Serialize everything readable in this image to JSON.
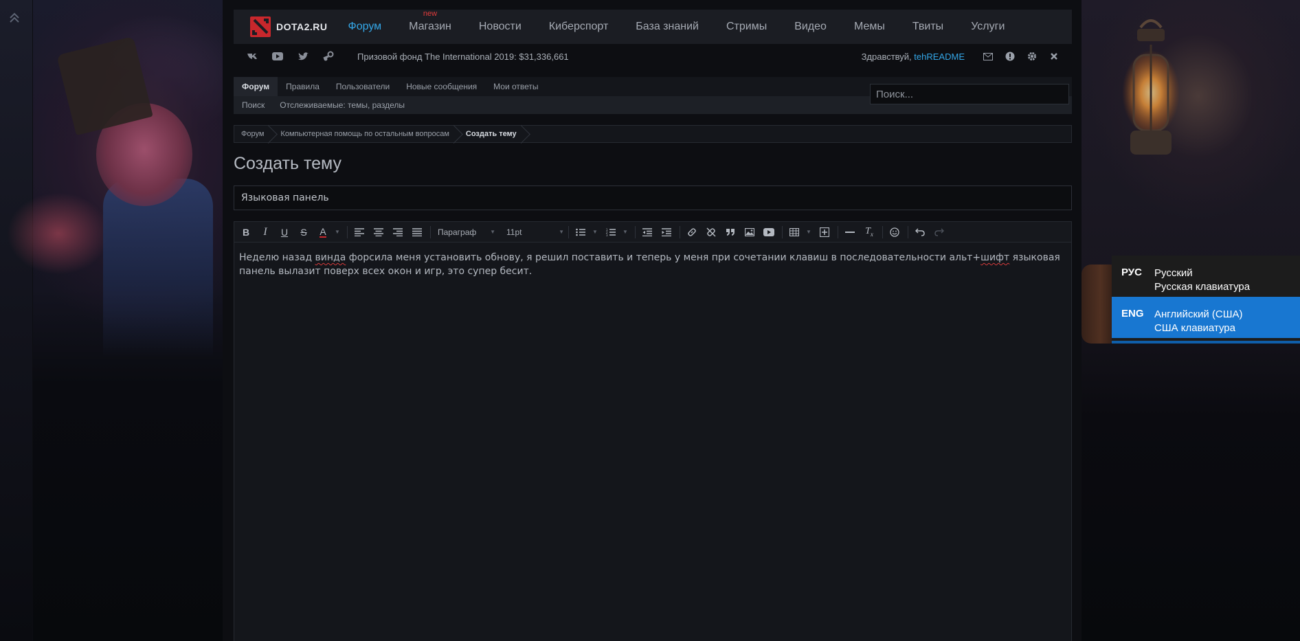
{
  "site": {
    "logo_text": "DOTA2.RU",
    "nav": [
      {
        "label": "Форум",
        "active": true
      },
      {
        "label": "Магазин",
        "badge": "new"
      },
      {
        "label": "Новости"
      },
      {
        "label": "Киберспорт"
      },
      {
        "label": "База знаний"
      },
      {
        "label": "Стримы"
      },
      {
        "label": "Видео"
      },
      {
        "label": "Мемы"
      },
      {
        "label": "Твиты"
      },
      {
        "label": "Услуги"
      }
    ],
    "social_icons": [
      "vk-icon",
      "youtube-icon",
      "twitter-icon",
      "steam-icon"
    ],
    "prize_text": "Призовой фонд The International 2019: $31,336,661",
    "greeting_prefix": "Здравствуй,",
    "username": "tehREADME",
    "user_tools": [
      "envelope-icon",
      "alert-icon",
      "gear-icon",
      "close-icon"
    ]
  },
  "forum_tabs": {
    "row1": [
      "Форум",
      "Правила",
      "Пользователи",
      "Новые сообщения",
      "Мои ответы"
    ],
    "row2": [
      "Поиск",
      "Отслеживаемые: темы, разделы"
    ],
    "search_placeholder": "Поиск..."
  },
  "breadcrumb": [
    "Форум",
    "Компьютерная помощь по остальным вопросам",
    "Создать тему"
  ],
  "page": {
    "title": "Создать тему",
    "topic_title_value": "Языковая панель"
  },
  "editor": {
    "paragraph_select": "Параграф",
    "font_size_select": "11pt",
    "body_parts": [
      "Неделю назад ",
      "винда",
      " форсила меня установить обнову, я решил поставить и теперь у меня при сочетании клавиш в последовательности альт+",
      "шифт",
      " языковая панель вылазит поверх всех окон и игр, это супер бесит."
    ]
  },
  "language_flyout": [
    {
      "code": "РУС",
      "name": "Русский",
      "keyboard": "Русская клавиатура",
      "selected": false
    },
    {
      "code": "ENG",
      "name": "Английский (США)",
      "keyboard": "США клавиатура",
      "selected": true
    }
  ],
  "colors": {
    "accent": "#34a7e8",
    "badge": "#e23c3c",
    "flyout_selected": "#1877d1"
  }
}
